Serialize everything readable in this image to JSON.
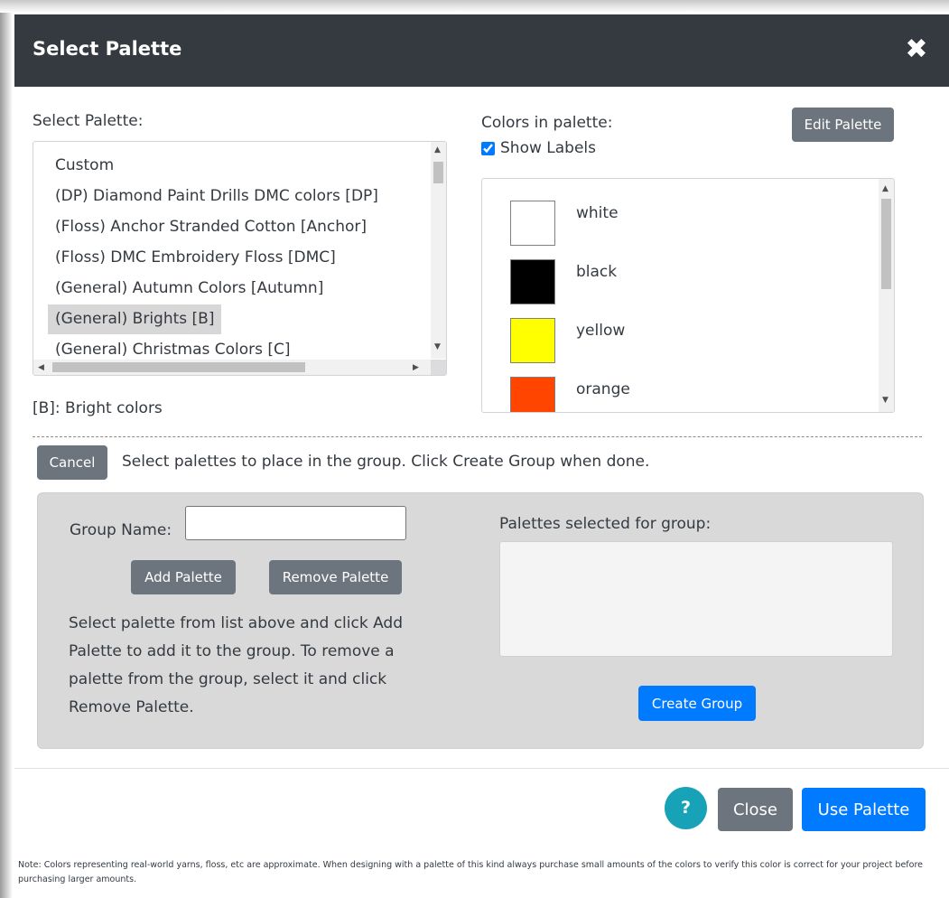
{
  "dialog": {
    "title": "Select Palette",
    "close_glyph": "✖"
  },
  "palette_list": {
    "label": "Select Palette:",
    "items": [
      {
        "label": "Custom",
        "selected": false
      },
      {
        "label": "(DP) Diamond Paint Drills DMC colors [DP]",
        "selected": false
      },
      {
        "label": "(Floss) Anchor Stranded Cotton [Anchor]",
        "selected": false
      },
      {
        "label": "(Floss) DMC Embroidery Floss [DMC]",
        "selected": false
      },
      {
        "label": "(General) Autumn Colors [Autumn]",
        "selected": false
      },
      {
        "label": "(General) Brights [B]",
        "selected": true
      },
      {
        "label": "(General) Christmas Colors [C]",
        "selected": false
      }
    ],
    "description": "[B]: Bright colors"
  },
  "colors_panel": {
    "label": "Colors in palette:",
    "show_labels_label": "Show Labels",
    "show_labels_checked": true,
    "edit_button": "Edit Palette",
    "colors": [
      {
        "name": "white",
        "hex": "#ffffff"
      },
      {
        "name": "black",
        "hex": "#000000"
      },
      {
        "name": "yellow",
        "hex": "#ffff00"
      },
      {
        "name": "orange",
        "hex": "#ff4500"
      }
    ]
  },
  "group_mode": {
    "cancel_button": "Cancel",
    "instruction": "Select palettes to place in the group. Click Create Group when done.",
    "group_name_label": "Group Name:",
    "group_name_value": "",
    "add_button": "Add Palette",
    "remove_button": "Remove Palette",
    "help_text": "Select palette from list above and click Add Palette to add it to the group. To remove a palette from the group, select it and click Remove Palette.",
    "selected_label": "Palettes selected for group:",
    "selected_items": [],
    "create_button": "Create Group"
  },
  "footer": {
    "help_button": "?",
    "close_button": "Close",
    "use_button": "Use Palette",
    "note": "Note: Colors representing real-world yarns, floss, etc are approximate. When designing with a palette of this kind always purchase small amounts of the colors to verify this color is correct for your project before purchasing larger amounts."
  },
  "accent_colors": {
    "header_bg": "#343a40",
    "primary": "#007bff",
    "secondary": "#6c757d",
    "info": "#17a2b8",
    "selected_item_bg": "#d7d7d7"
  }
}
